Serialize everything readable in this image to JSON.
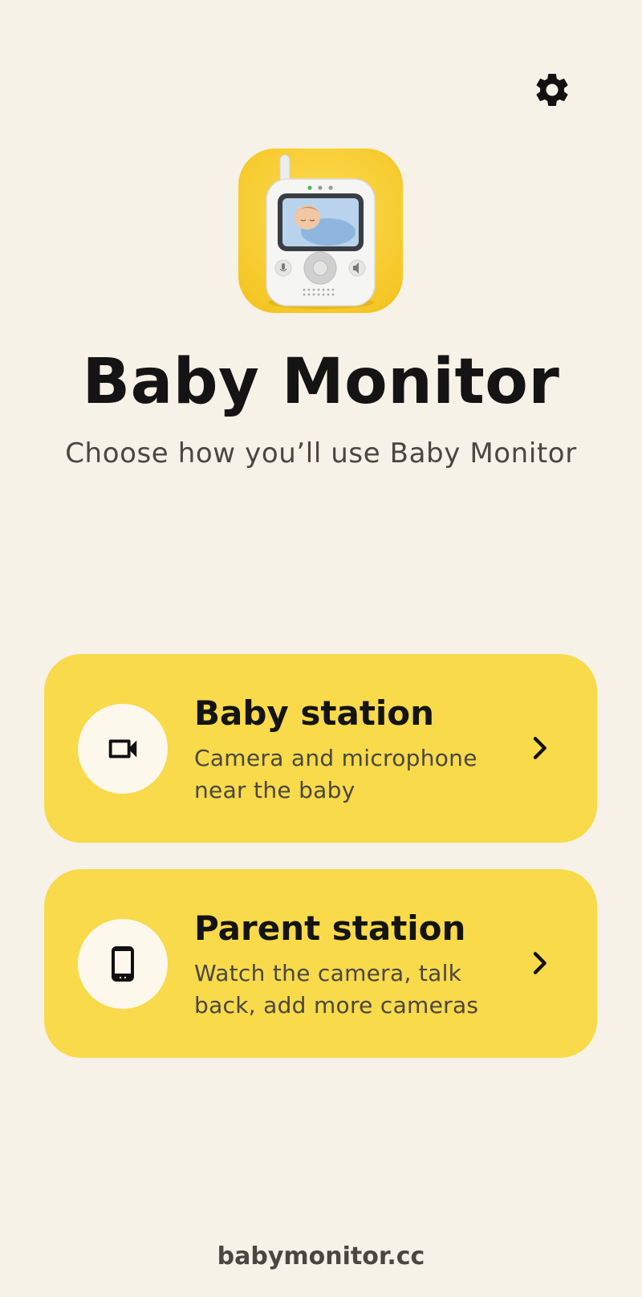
{
  "header": {
    "settings_icon": "gear-icon"
  },
  "app": {
    "icon": "baby-monitor-device-icon",
    "title": "Baby Monitor",
    "subtitle": "Choose how you’ll use Baby Monitor"
  },
  "cards": [
    {
      "title": "Baby station",
      "description": "Camera and microphone near the baby",
      "icon": "video-camera-icon"
    },
    {
      "title": "Parent station",
      "description": "Watch the camera, talk back, add more cameras",
      "icon": "smartphone-icon"
    }
  ],
  "footer": {
    "text": "babymonitor.cc"
  },
  "colors": {
    "background": "#F7F2E7",
    "card": "#F8DA4B",
    "icon_circle": "#FCF8EC",
    "text_primary": "#141414",
    "text_secondary": "#4A4640"
  }
}
